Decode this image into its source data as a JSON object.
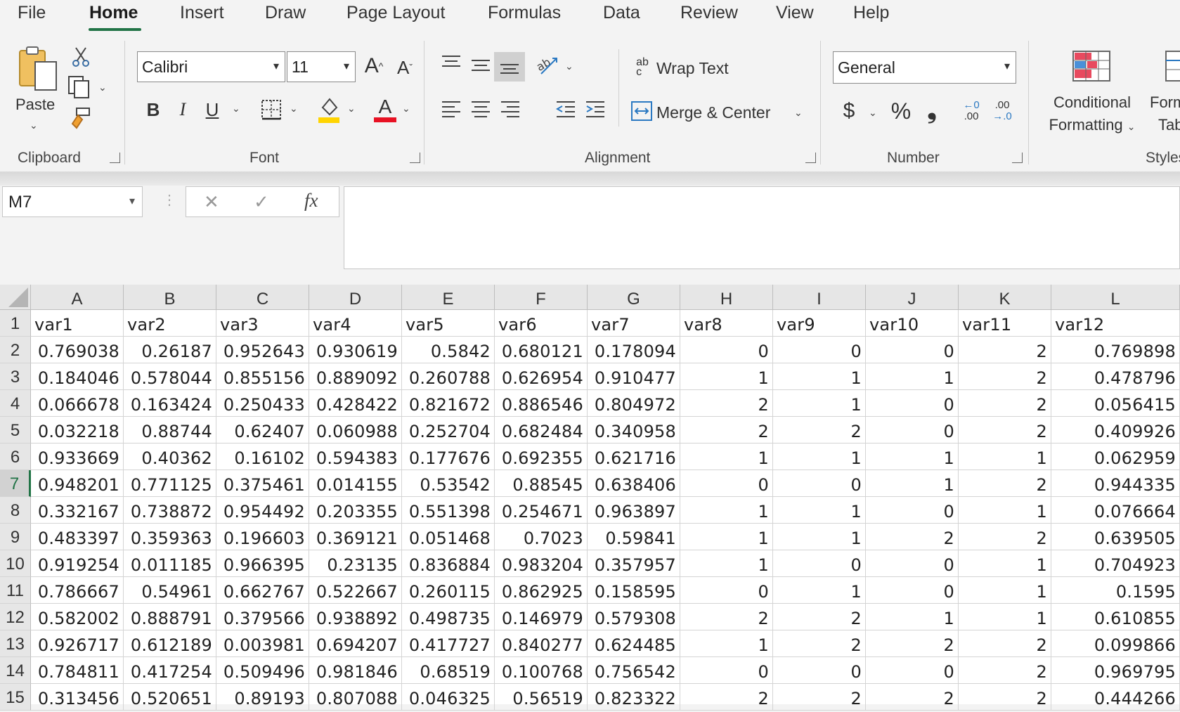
{
  "menu": {
    "items": [
      "File",
      "Home",
      "Insert",
      "Draw",
      "Page Layout",
      "Formulas",
      "Data",
      "Review",
      "View",
      "Help"
    ],
    "active": "Home"
  },
  "ribbon": {
    "clipboard": {
      "paste_label": "Paste",
      "group_label": "Clipboard"
    },
    "font": {
      "font_name": "Calibri",
      "font_size": "11",
      "group_label": "Font",
      "bold": "B",
      "italic": "I",
      "underline": "U",
      "grow": "A",
      "shrink": "A",
      "font_color_glyph": "A"
    },
    "alignment": {
      "wrap_text": "Wrap Text",
      "merge_center": "Merge & Center",
      "group_label": "Alignment",
      "wrap_glyph": "ab\nc"
    },
    "number": {
      "format": "General",
      "group_label": "Number",
      "currency": "$",
      "percent": "%",
      "comma": "❟",
      "inc_decimal_top": "←0",
      "inc_decimal_bottom": ".00",
      "dec_decimal_top": ".00",
      "dec_decimal_bottom": "→.0"
    },
    "styles": {
      "conditional_formatting_line1": "Conditional",
      "conditional_formatting_line2": "Formatting",
      "format_table_line1": "Form",
      "format_table_line2": "Tab",
      "group_label": "Styles"
    }
  },
  "formula_bar": {
    "name_box": "M7",
    "fx": "fx",
    "cancel": "✕",
    "enter": "✓",
    "value": ""
  },
  "colors": {
    "accent": "#217346",
    "font_color": "#e81123",
    "highlight": "#ffd400"
  },
  "sheet": {
    "columns": [
      "A",
      "B",
      "C",
      "D",
      "E",
      "F",
      "G",
      "H",
      "I",
      "J",
      "K",
      "L"
    ],
    "selected_row": "7",
    "rows": [
      {
        "n": "1",
        "cells": [
          "var1",
          "var2",
          "var3",
          "var4",
          "var5",
          "var6",
          "var7",
          "var8",
          "var9",
          "var10",
          "var11",
          "var12"
        ]
      },
      {
        "n": "2",
        "cells": [
          "0.769038",
          "0.26187",
          "0.952643",
          "0.930619",
          "0.5842",
          "0.680121",
          "0.178094",
          "0",
          "0",
          "0",
          "2",
          "0.769898"
        ]
      },
      {
        "n": "3",
        "cells": [
          "0.184046",
          "0.578044",
          "0.855156",
          "0.889092",
          "0.260788",
          "0.626954",
          "0.910477",
          "1",
          "1",
          "1",
          "2",
          "0.478796"
        ]
      },
      {
        "n": "4",
        "cells": [
          "0.066678",
          "0.163424",
          "0.250433",
          "0.428422",
          "0.821672",
          "0.886546",
          "0.804972",
          "2",
          "1",
          "0",
          "2",
          "0.056415"
        ]
      },
      {
        "n": "5",
        "cells": [
          "0.032218",
          "0.88744",
          "0.62407",
          "0.060988",
          "0.252704",
          "0.682484",
          "0.340958",
          "2",
          "2",
          "0",
          "2",
          "0.409926"
        ]
      },
      {
        "n": "6",
        "cells": [
          "0.933669",
          "0.40362",
          "0.16102",
          "0.594383",
          "0.177676",
          "0.692355",
          "0.621716",
          "1",
          "1",
          "1",
          "1",
          "0.062959"
        ]
      },
      {
        "n": "7",
        "cells": [
          "0.948201",
          "0.771125",
          "0.375461",
          "0.014155",
          "0.53542",
          "0.88545",
          "0.638406",
          "0",
          "0",
          "1",
          "2",
          "0.944335"
        ]
      },
      {
        "n": "8",
        "cells": [
          "0.332167",
          "0.738872",
          "0.954492",
          "0.203355",
          "0.551398",
          "0.254671",
          "0.963897",
          "1",
          "1",
          "0",
          "1",
          "0.076664"
        ]
      },
      {
        "n": "9",
        "cells": [
          "0.483397",
          "0.359363",
          "0.196603",
          "0.369121",
          "0.051468",
          "0.7023",
          "0.59841",
          "1",
          "1",
          "2",
          "2",
          "0.639505"
        ]
      },
      {
        "n": "10",
        "cells": [
          "0.919254",
          "0.011185",
          "0.966395",
          "0.23135",
          "0.836884",
          "0.983204",
          "0.357957",
          "1",
          "0",
          "0",
          "1",
          "0.704923"
        ]
      },
      {
        "n": "11",
        "cells": [
          "0.786667",
          "0.54961",
          "0.662767",
          "0.522667",
          "0.260115",
          "0.862925",
          "0.158595",
          "0",
          "1",
          "0",
          "1",
          "0.1595"
        ]
      },
      {
        "n": "12",
        "cells": [
          "0.582002",
          "0.888791",
          "0.379566",
          "0.938892",
          "0.498735",
          "0.146979",
          "0.579308",
          "2",
          "2",
          "1",
          "1",
          "0.610855"
        ]
      },
      {
        "n": "13",
        "cells": [
          "0.926717",
          "0.612189",
          "0.003981",
          "0.694207",
          "0.417727",
          "0.840277",
          "0.624485",
          "1",
          "2",
          "2",
          "2",
          "0.099866"
        ]
      },
      {
        "n": "14",
        "cells": [
          "0.784811",
          "0.417254",
          "0.509496",
          "0.981846",
          "0.68519",
          "0.100768",
          "0.756542",
          "0",
          "0",
          "0",
          "2",
          "0.969795"
        ]
      },
      {
        "n": "15",
        "cells": [
          "0.313456",
          "0.520651",
          "0.89193",
          "0.807088",
          "0.046325",
          "0.56519",
          "0.823322",
          "2",
          "2",
          "2",
          "2",
          "0.444266"
        ]
      }
    ]
  }
}
